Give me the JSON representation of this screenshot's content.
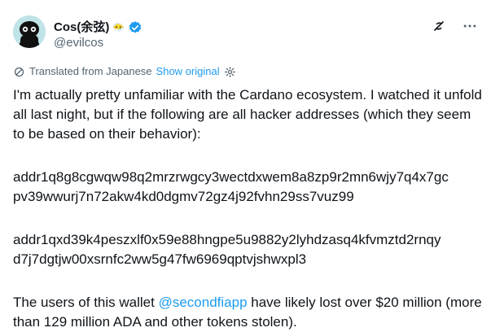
{
  "author": {
    "name": "Cos(余弦)",
    "handle": "@evilcos",
    "emoji": "😶‍🌫️",
    "verified_color": "#1d9bf0"
  },
  "actions": {
    "grok_icon": "grok-icon",
    "more_icon": "more-icon"
  },
  "translation": {
    "label": "Translated from Japanese",
    "show_original": "Show original"
  },
  "post": {
    "intro": "I'm actually pretty unfamiliar with the Cardano ecosystem. I watched it unfold all last night, but if the following are all hacker addresses (which they seem to be based on their behavior):",
    "address1_line1": "addr1q8g8cgwqw98q2mrzrwgcy3wectdxwem8a8zp9r2mn6wjy7q4x7gc",
    "address1_line2": "pv39wwurj7n72akw4kd0dgmv72gz4j92fvhn29ss7vuz99",
    "address2_line1": "addr1qxd39k4peszxlf0x59e88hngpe5u9882y2lyhdzasq4kfvmztd2rnqy",
    "address2_line2": "d7j7dgtjw00xsrnfc2ww5g47fw6969qptvjshwxpl3",
    "closing_before": "The users of this wallet ",
    "mention": "@secondfiapp",
    "closing_after": " have likely lost over $20 million (more than 129 million ADA and other tokens stolen).",
    "link_color": "#1d9bf0"
  }
}
